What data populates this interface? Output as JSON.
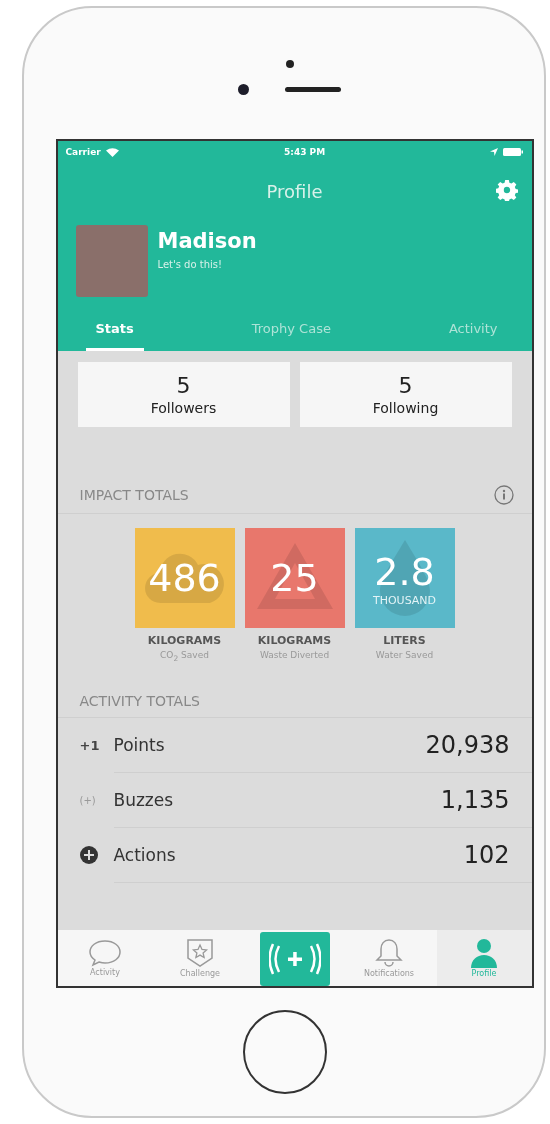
{
  "status_bar": {
    "carrier": "Carrier",
    "time": "5:43 PM"
  },
  "nav": {
    "title": "Profile"
  },
  "profile": {
    "name": "Madison",
    "tagline": "Let's do this!"
  },
  "tabs": [
    {
      "label": "Stats",
      "selected": true
    },
    {
      "label": "Trophy Case",
      "selected": false
    },
    {
      "label": "Activity",
      "selected": false
    }
  ],
  "social": [
    {
      "count": "5",
      "label": "Followers"
    },
    {
      "count": "5",
      "label": "Following"
    }
  ],
  "impact": {
    "title": "IMPACT TOTALS",
    "tiles": [
      {
        "kind": "cloud",
        "color": "#f0bc4c",
        "value": "486",
        "unit": "KILOGRAMS",
        "caption": "CO$_{2}$ Saved"
      },
      {
        "kind": "recycle",
        "color": "#e8776c",
        "value": "25",
        "unit": "KILOGRAMS",
        "caption": "Waste Diverted"
      },
      {
        "kind": "drop",
        "color": "#5ab8c9",
        "value": "2.8",
        "multiplier": "THOUSAND",
        "unit": "LITERS",
        "caption": "Water Saved"
      }
    ]
  },
  "activity": {
    "title": "ACTIVITY TOTALS",
    "rows": [
      {
        "kind": "text",
        "icon": "+1",
        "label": "Points",
        "value": "20,938"
      },
      {
        "kind": "text",
        "icon": "(+)",
        "label": "Buzzes",
        "value": "1,135"
      },
      {
        "kind": "circle-plus",
        "label": "Actions",
        "value": "102"
      }
    ]
  },
  "tab_bar": [
    {
      "kind": "bubble",
      "label": "Activity",
      "selected": false
    },
    {
      "kind": "badge",
      "label": "Challenge",
      "selected": false
    },
    {
      "kind": "buzz",
      "selected": false
    },
    {
      "kind": "bell",
      "label": "Notifications",
      "selected": false
    },
    {
      "kind": "person",
      "label": "Profile",
      "selected": true
    }
  ]
}
